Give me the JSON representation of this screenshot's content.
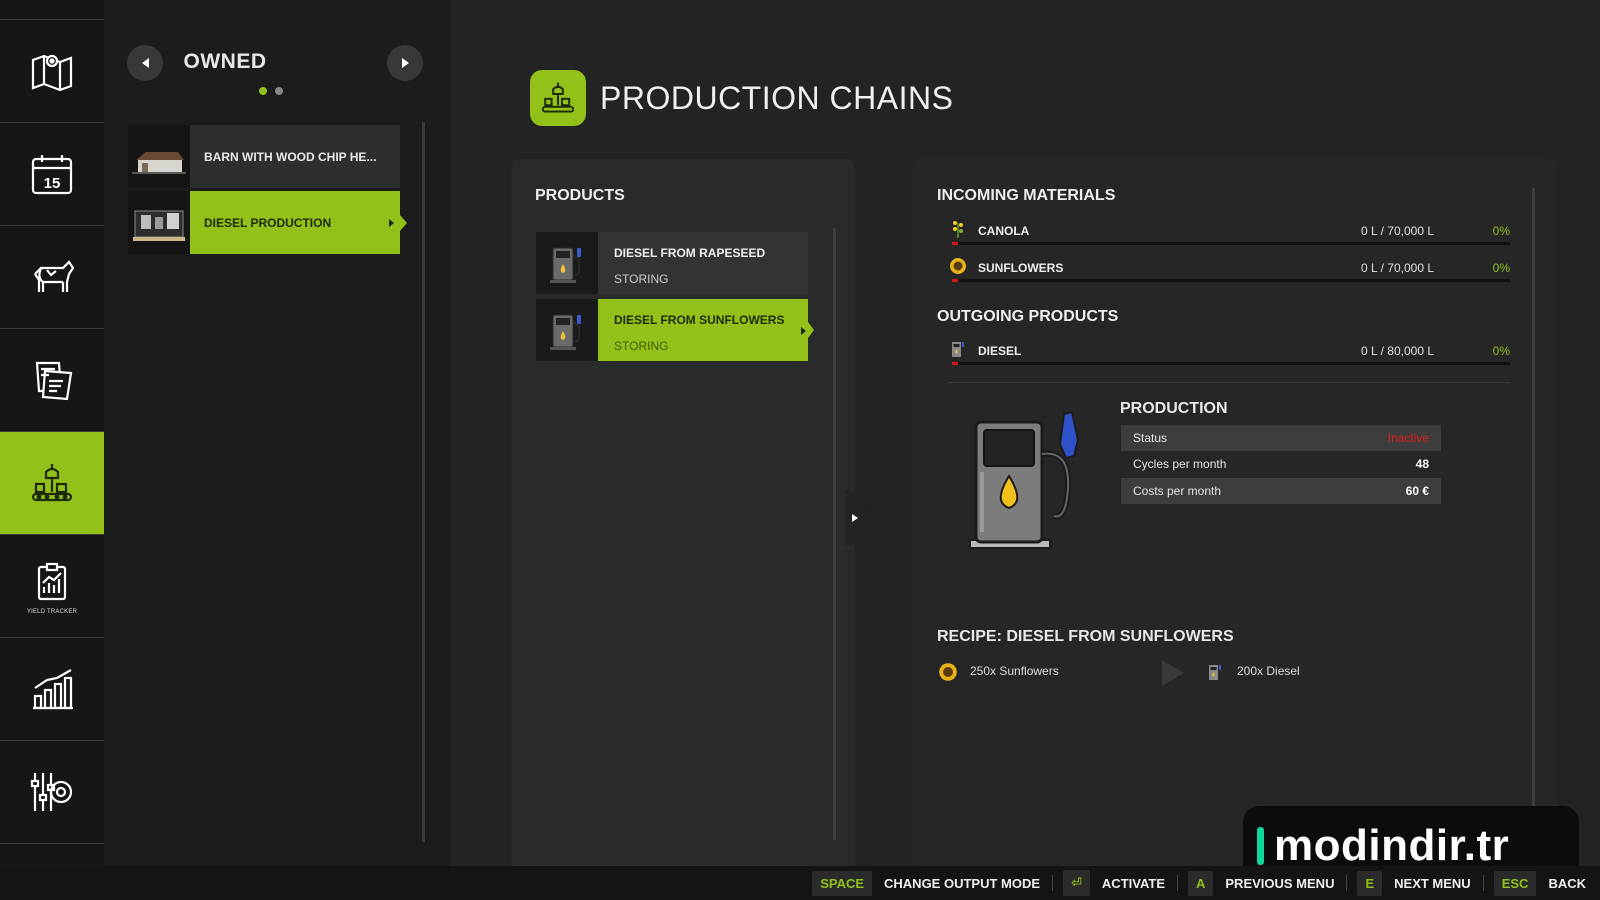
{
  "sidebar": {
    "items": [
      {
        "icon": "map-icon"
      },
      {
        "icon": "calendar-icon",
        "label": "15"
      },
      {
        "icon": "animals-icon"
      },
      {
        "icon": "contracts-icon"
      },
      {
        "icon": "production-icon",
        "active": true
      },
      {
        "icon": "yield-tracker-icon",
        "label": "YIELD TRACKER"
      },
      {
        "icon": "statistics-icon"
      },
      {
        "icon": "settings-icon"
      }
    ]
  },
  "owned": {
    "title": "OWNED",
    "pages": 2,
    "current_page": 1,
    "items": [
      {
        "label": "BARN WITH WOOD CHIP HE..."
      },
      {
        "label": "DIESEL PRODUCTION",
        "selected": true
      }
    ]
  },
  "header": {
    "title": "PRODUCTION CHAINS"
  },
  "products": {
    "heading": "PRODUCTS",
    "items": [
      {
        "name": "DIESEL FROM RAPESEED",
        "mode": "STORING"
      },
      {
        "name": "DIESEL FROM SUNFLOWERS",
        "mode": "STORING",
        "selected": true
      }
    ]
  },
  "incoming": {
    "heading": "INCOMING MATERIALS",
    "items": [
      {
        "name": "CANOLA",
        "amount": "0 L / 70,000 L",
        "percent": "0%",
        "fill": 0
      },
      {
        "name": "SUNFLOWERS",
        "amount": "0 L / 70,000 L",
        "percent": "0%",
        "fill": 0
      }
    ]
  },
  "outgoing": {
    "heading": "OUTGOING PRODUCTS",
    "items": [
      {
        "name": "DIESEL",
        "amount": "0 L / 80,000 L",
        "percent": "0%",
        "fill": 0
      }
    ]
  },
  "production": {
    "heading": "PRODUCTION",
    "rows": [
      {
        "label": "Status",
        "value": "Inactive"
      },
      {
        "label": "Cycles per month",
        "value": "48"
      },
      {
        "label": "Costs per month",
        "value": "60 €"
      }
    ]
  },
  "recipe": {
    "heading": "RECIPE: DIESEL FROM SUNFLOWERS",
    "input": "250x Sunflowers",
    "output": "200x Diesel"
  },
  "watermark": {
    "text": "modindir.tr"
  },
  "bottom_bar": {
    "actions": [
      {
        "key": "SPACE",
        "label": "CHANGE OUTPUT MODE"
      },
      {
        "key": "⏎",
        "label": "ACTIVATE"
      },
      {
        "key": "A",
        "label": "PREVIOUS MENU"
      },
      {
        "key": "E",
        "label": "NEXT MENU"
      },
      {
        "key": "ESC",
        "label": "BACK"
      }
    ]
  },
  "colors": {
    "accent": "#92c11a",
    "status_inactive": "#e01e1e",
    "bar_fill": "#d21818",
    "watermark_accent": "#0fd59a"
  }
}
